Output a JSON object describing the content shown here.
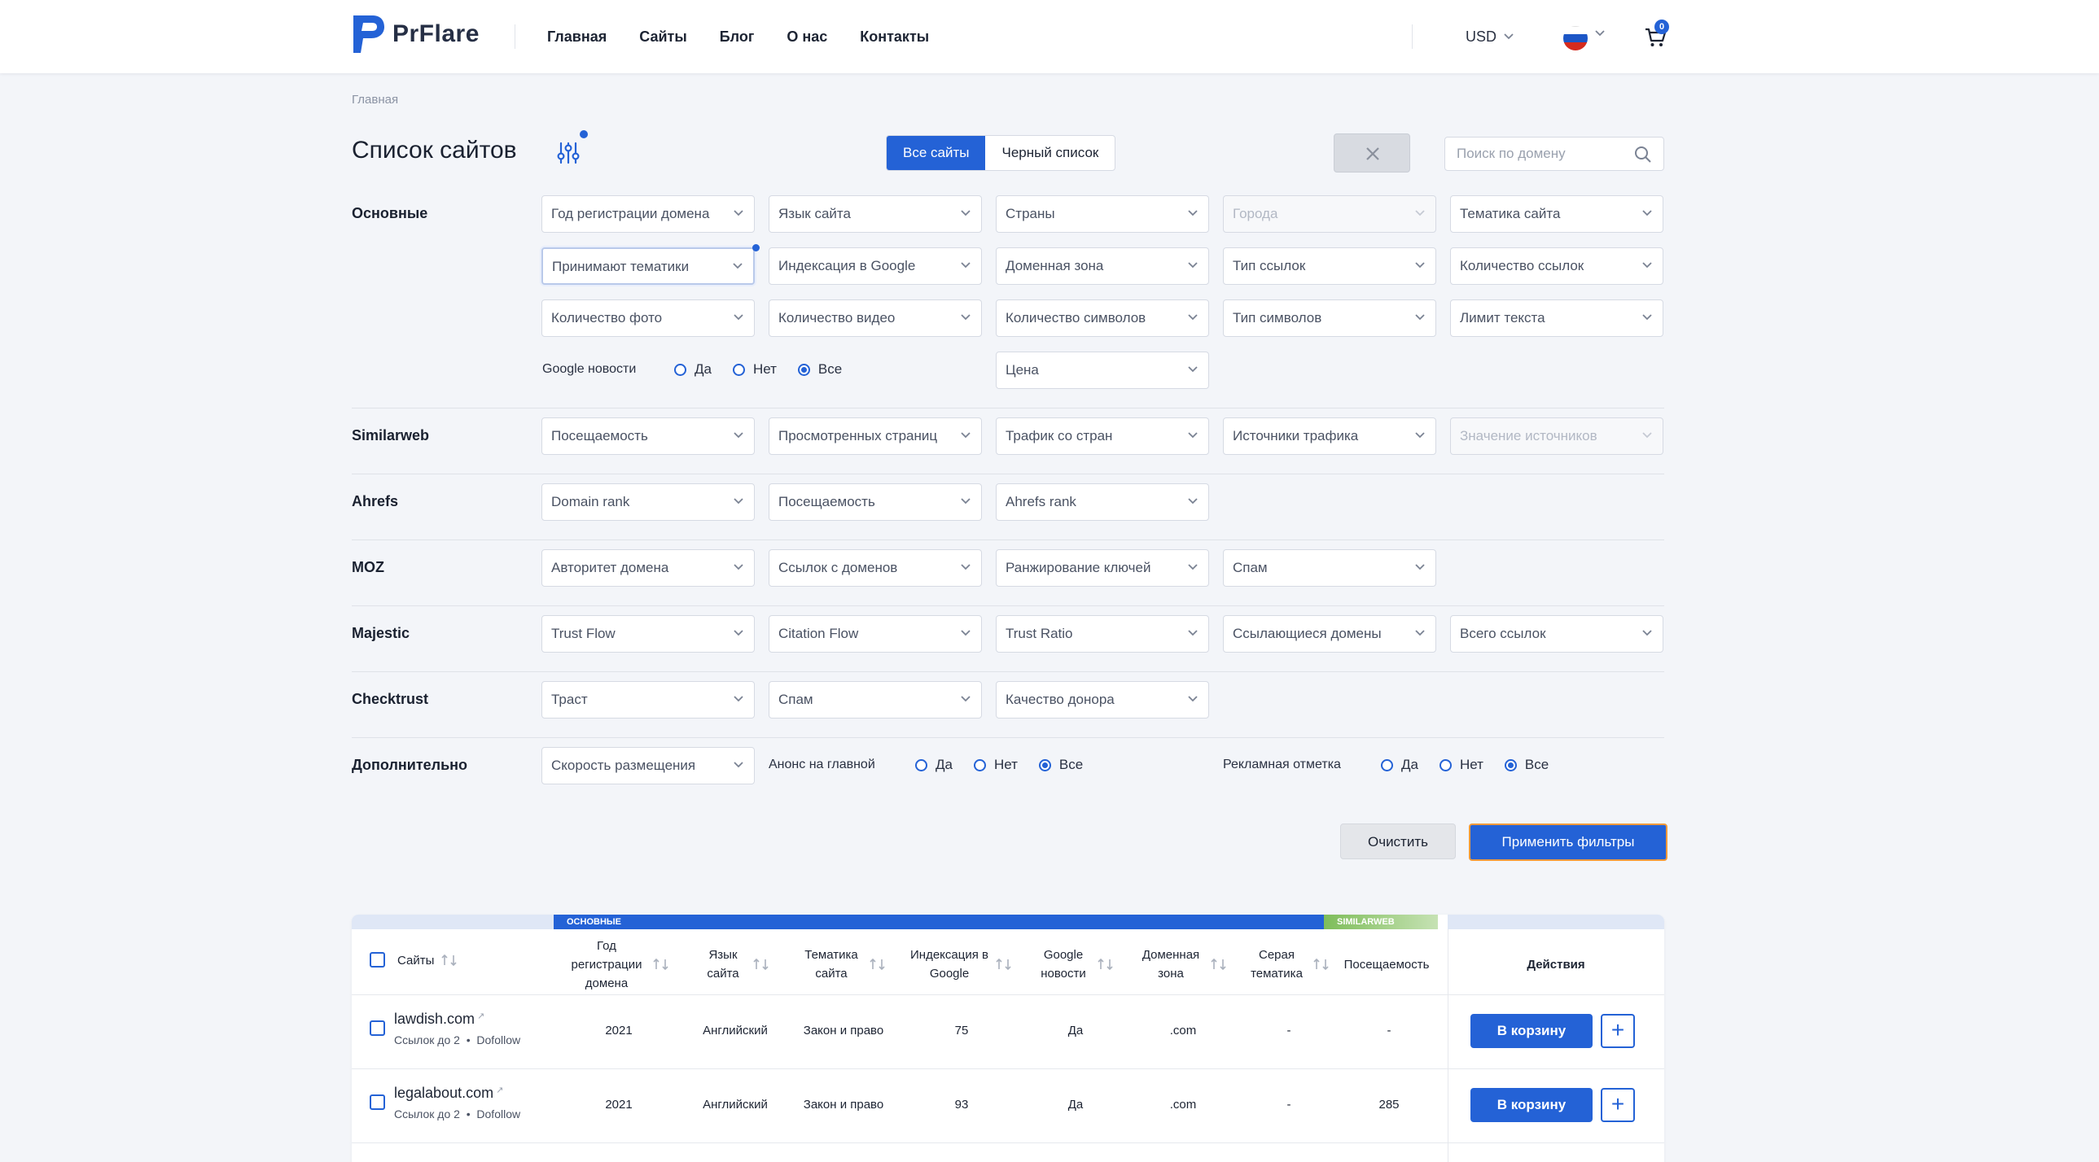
{
  "header": {
    "logo_text": "PrFlare",
    "nav": [
      "Главная",
      "Сайты",
      "Блог",
      "О нас",
      "Контакты"
    ],
    "currency": "USD",
    "cart_count": "0"
  },
  "breadcrumb": "Главная",
  "title": "Список сайтов",
  "tabs": {
    "all": "Все сайты",
    "blacklist": "Черный список"
  },
  "search": {
    "placeholder": "Поиск по домену"
  },
  "sections": {
    "basic": "Основные",
    "similarweb": "Similarweb",
    "ahrefs": "Ahrefs",
    "moz": "MOZ",
    "majestic": "Majestic",
    "checktrust": "Checktrust",
    "extra": "Дополнительно"
  },
  "filters": {
    "basic": [
      "Год регистрации домена",
      "Язык сайта",
      "Страны",
      "Города",
      "Тематика сайта",
      "Принимают тематики",
      "Индексация в Google",
      "Доменная зона",
      "Тип ссылок",
      "Количество ссылок",
      "Количество фото",
      "Количество видео",
      "Количество символов",
      "Тип символов",
      "Лимит текста"
    ],
    "price": "Цена",
    "google_news": {
      "label": "Google новости",
      "yes": "Да",
      "no": "Нет",
      "all": "Все"
    },
    "similarweb": [
      "Посещаемость",
      "Просмотренных страниц",
      "Трафик со стран",
      "Источники трафика",
      "Значение источников"
    ],
    "ahrefs": [
      "Domain rank",
      "Посещаемость",
      "Ahrefs rank"
    ],
    "moz": [
      "Авторитет домена",
      "Ссылок с доменов",
      "Ранжирование ключей",
      "Спам"
    ],
    "majestic": [
      "Trust Flow",
      "Citation Flow",
      "Trust Ratio",
      "Ссылающиеся домены",
      "Всего ссылок"
    ],
    "checktrust": [
      "Траст",
      "Спам",
      "Качество донора"
    ],
    "extra_select": "Скорость размещения",
    "announce": {
      "label": "Анонс на главной",
      "yes": "Да",
      "no": "Нет",
      "all": "Все"
    },
    "ad_mark": {
      "label": "Рекламная отметка",
      "yes": "Да",
      "no": "Нет",
      "all": "Все"
    }
  },
  "buttons": {
    "clear": "Очистить",
    "apply": "Применить фильтры"
  },
  "table": {
    "band_main": "ОСНОВНЫЕ",
    "band_similarweb": "SIMILARWEB",
    "headers": {
      "sites": "Сайты",
      "year": "Год регистрации домена",
      "lang": "Язык сайта",
      "theme": "Тематика сайта",
      "index": "Индексация в Google",
      "news": "Google новости",
      "zone": "Доменная зона",
      "grey": "Серая тематика",
      "traffic": "Посещаемость",
      "actions": "Действия"
    },
    "rows": [
      {
        "site": "lawdish.com",
        "links": "Ссылок до 2",
        "type": "Dofollow",
        "year": "2021",
        "lang": "Английский",
        "theme": "Закон и право",
        "index": "75",
        "news": "Да",
        "zone": ".com",
        "grey": "-",
        "traffic": "-",
        "cart": "В корзину"
      },
      {
        "site": "legalabout.com",
        "links": "Ссылок до 2",
        "type": "Dofollow",
        "year": "2021",
        "lang": "Английский",
        "theme": "Закон и право",
        "index": "93",
        "news": "Да",
        "zone": ".com",
        "grey": "-",
        "traffic": "285",
        "cart": "В корзину"
      }
    ]
  },
  "colors": {
    "accent": "#2462d6",
    "similarweb": "#7ebd5a"
  }
}
